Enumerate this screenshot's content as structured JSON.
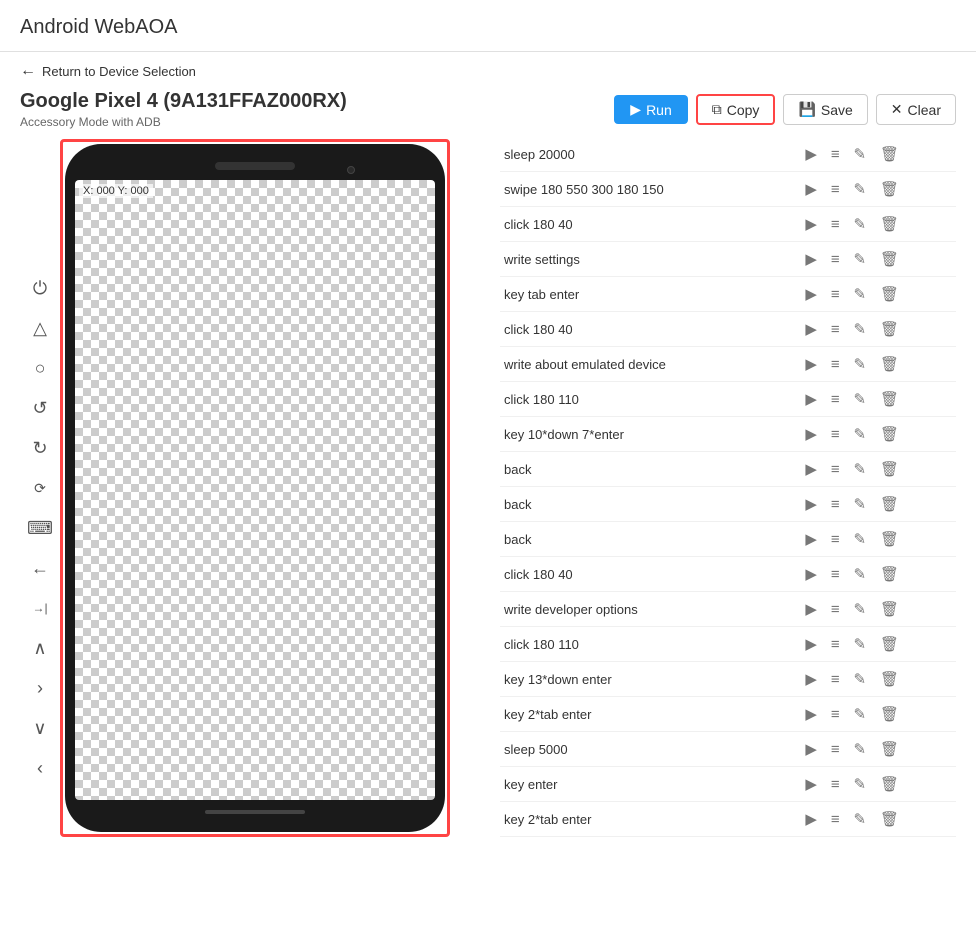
{
  "app": {
    "title": "Android WebAOA"
  },
  "nav": {
    "back_label": "Return to Device Selection"
  },
  "device": {
    "name": "Google Pixel 4 (9A131FFAZ000RX)",
    "mode": "Accessory Mode with ADB",
    "coords": "X: 000 Y: 000"
  },
  "toolbar": {
    "run_label": "Run",
    "copy_label": "Copy",
    "save_label": "Save",
    "clear_label": "Clear"
  },
  "commands": [
    {
      "id": 1,
      "label": "sleep 20000"
    },
    {
      "id": 2,
      "label": "swipe 180 550 300 180 150"
    },
    {
      "id": 3,
      "label": "click 180 40"
    },
    {
      "id": 4,
      "label": "write settings"
    },
    {
      "id": 5,
      "label": "key tab enter"
    },
    {
      "id": 6,
      "label": "click 180 40"
    },
    {
      "id": 7,
      "label": "write about emulated device"
    },
    {
      "id": 8,
      "label": "click 180 110"
    },
    {
      "id": 9,
      "label": "key 10*down 7*enter"
    },
    {
      "id": 10,
      "label": "back"
    },
    {
      "id": 11,
      "label": "back"
    },
    {
      "id": 12,
      "label": "back"
    },
    {
      "id": 13,
      "label": "click 180 40"
    },
    {
      "id": 14,
      "label": "write developer options"
    },
    {
      "id": 15,
      "label": "click 180 110"
    },
    {
      "id": 16,
      "label": "key 13*down enter"
    },
    {
      "id": 17,
      "label": "key 2*tab enter"
    },
    {
      "id": 18,
      "label": "sleep 5000"
    },
    {
      "id": 19,
      "label": "key enter"
    },
    {
      "id": 20,
      "label": "key 2*tab enter"
    }
  ],
  "controls": [
    {
      "name": "power",
      "symbol": "⏻"
    },
    {
      "name": "triangle",
      "symbol": "△"
    },
    {
      "name": "circle",
      "symbol": "○"
    },
    {
      "name": "rotate-ccw",
      "symbol": "↺"
    },
    {
      "name": "rotate-cw",
      "symbol": "↻"
    },
    {
      "name": "rotate-lock",
      "symbol": "🔄"
    },
    {
      "name": "keyboard",
      "symbol": "⌨"
    },
    {
      "name": "arrow-left",
      "symbol": "←"
    },
    {
      "name": "arrow-right",
      "symbol": "→|"
    },
    {
      "name": "chevron-up",
      "symbol": "∧"
    },
    {
      "name": "chevron-right",
      "symbol": "›"
    },
    {
      "name": "chevron-down",
      "symbol": "∨"
    },
    {
      "name": "chevron-left",
      "symbol": "‹"
    }
  ]
}
